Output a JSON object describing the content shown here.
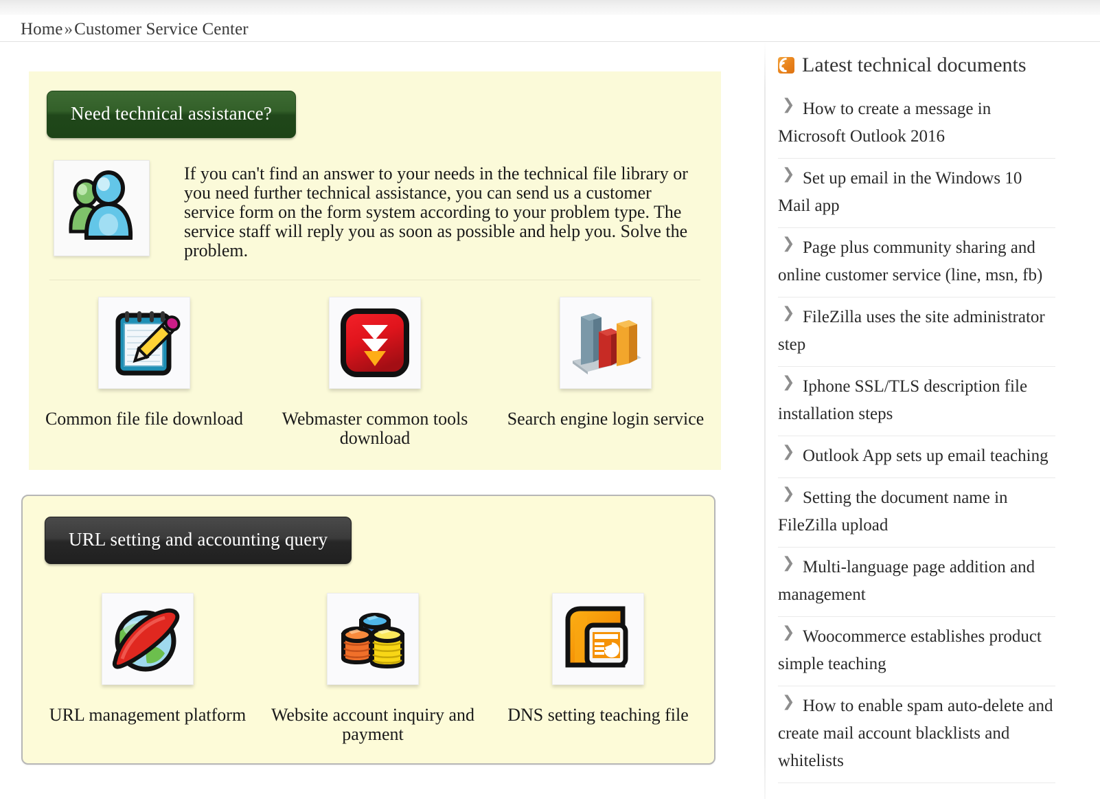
{
  "breadcrumb": {
    "home": "Home",
    "separator": "»",
    "current": "Customer Service Center"
  },
  "support_panel": {
    "heading_button": "Need technical assistance?",
    "people_icon": "people-group-icon",
    "paragraph": "If you can't find an answer to your needs in the technical file library or you need further technical assistance, you can send us a customer service form on the form system according to your problem type. The service staff will reply you as soon as possible and help you. Solve the problem.",
    "tiles": [
      {
        "label": "Common file file download",
        "icon": "notepad-pencil-icon"
      },
      {
        "label": "Webmaster common tools download",
        "icon": "download-arrows-icon"
      },
      {
        "label": "Search engine login service",
        "icon": "bar-chart-icon"
      }
    ]
  },
  "url_panel": {
    "heading_button": "URL setting and accounting query",
    "tiles": [
      {
        "label": "URL management platform",
        "icon": "globe-swoosh-icon"
      },
      {
        "label": "Website account inquiry and payment",
        "icon": "coin-stacks-icon"
      },
      {
        "label": "DNS setting teaching file",
        "icon": "presentation-file-icon"
      }
    ]
  },
  "sidebar": {
    "title": "Latest technical documents",
    "rss_icon": "rss-icon",
    "items": [
      {
        "label": "How to create a message in Microsoft Outlook 2016"
      },
      {
        "label": "Set up email in the Windows 10 Mail app"
      },
      {
        "label": "Page plus community sharing and online customer service (line, msn, fb)"
      },
      {
        "label": "FileZilla uses the site administrator step"
      },
      {
        "label": "Iphone SSL/TLS description file installation steps"
      },
      {
        "label": "Outlook App sets up email teaching"
      },
      {
        "label": "Setting the document name in FileZilla upload"
      },
      {
        "label": "Multi-language page addition and management"
      },
      {
        "label": "Woocommerce establishes product simple teaching"
      },
      {
        "label": "How to enable spam auto-delete and create mail account blacklists and whitelists"
      }
    ]
  },
  "colors": {
    "panel_background": "#fbfad9",
    "green_button": "#25501d",
    "dark_button": "#2e2e2e",
    "rss_orange": "#e8821b",
    "chevron_gray": "#8d8d8d",
    "text": "#1a1a1a"
  }
}
